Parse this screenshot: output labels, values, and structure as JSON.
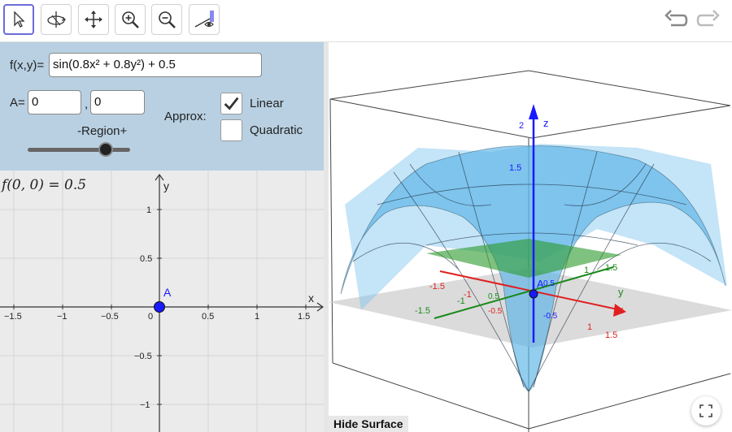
{
  "toolbar": {
    "tools": [
      {
        "icon": "move-arrow-icon",
        "active": true
      },
      {
        "icon": "rotate-view-icon",
        "active": false
      },
      {
        "icon": "move-graphics-view-icon",
        "active": false
      },
      {
        "icon": "zoom-in-icon",
        "active": false
      },
      {
        "icon": "zoom-out-icon",
        "active": false
      },
      {
        "icon": "view-from-icon",
        "active": false
      }
    ],
    "undo_icon": "undo-icon",
    "redo_icon": "redo-icon"
  },
  "algebra": {
    "function_label": "f(x,y)=",
    "function_value": "sin(0.8x² + 0.8y²) + 0.5",
    "point_label": "A=",
    "point_x": "0",
    "point_y": "0",
    "comma": ",",
    "region_label": "-Region+",
    "region_level": 0.76,
    "approx_label": "Approx:",
    "linear_label": "Linear",
    "linear_checked": true,
    "quadratic_label": "Quadratic",
    "quadratic_checked": false
  },
  "graph2d": {
    "value_text": "f(0, 0) = 0.5",
    "x_axis_label": "x",
    "y_axis_label": "y",
    "x_ticks": [
      "−1.5",
      "−1",
      "−0.5",
      "0",
      "0.5",
      "1",
      "1.5"
    ],
    "y_ticks": [
      "1",
      "0.5",
      "−0.5",
      "−1"
    ],
    "point_label": "A",
    "point_color": "#1a1aff"
  },
  "graph3d": {
    "z_axis_label": "z",
    "y_axis_label": "y",
    "x_axis_label": "x",
    "z_ticks": [
      "2",
      "1.5"
    ],
    "x_ticks": [
      "-1.5",
      "-1",
      "1",
      "1.5"
    ],
    "y_ticks": [
      "-1.5",
      "-1",
      "1",
      "1.5"
    ],
    "inner_ticks": [
      "0.5",
      "-0.5",
      "-0.5",
      "0.5"
    ],
    "point_label": "A",
    "surface_color": "#5ab4e8",
    "plane_color": "#2a9a2a",
    "z_axis_color": "#1a1aff",
    "x_axis_color": "#e02020",
    "y_axis_color": "#1a8a1a"
  },
  "hide_surface_label": "Hide Surface",
  "fullscreen_icon": "fullscreen-icon"
}
